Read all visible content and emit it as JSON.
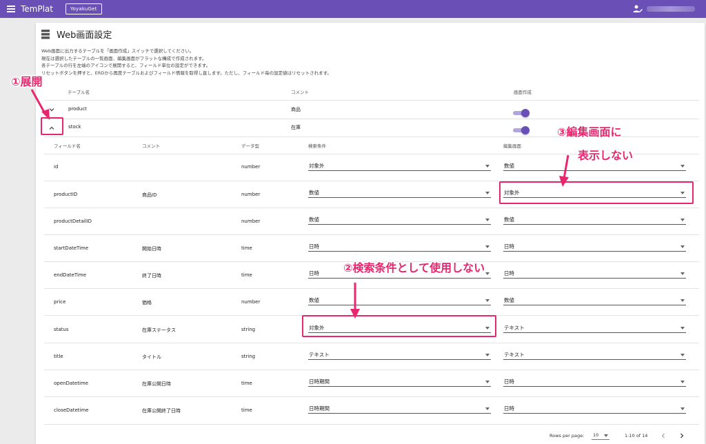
{
  "appbar": {
    "title": "TemPlat",
    "button": "YoyakuGet"
  },
  "page": {
    "title": "Web画面設定",
    "desc": [
      "Web画面に出力するテーブルを「画面作成」スイッチで選択してください。",
      "現在は選択したテーブルの一覧画面、編集画面がフラットな構成で作成されます。",
      "各テーブルの行を左端のアイコンで展開すると、フィールド単位の設定ができます。",
      "リセットボタンを押すと、ERDから再度テーブルおよびフィールド情報を取得し直します。ただし、フィールド毎の設定値はリセットされます。"
    ]
  },
  "table": {
    "headers": {
      "name": "テーブル名",
      "comment": "コメント",
      "create": "画面作成"
    },
    "rows": [
      {
        "name": "product",
        "comment": "商品",
        "enabled": true,
        "expanded": false
      },
      {
        "name": "stock",
        "comment": "在庫",
        "enabled": true,
        "expanded": true
      }
    ]
  },
  "fields": {
    "headers": {
      "name": "フィールド名",
      "comment": "コメント",
      "type": "データ型",
      "search": "検索条件",
      "edit": "編集画面"
    },
    "rows": [
      {
        "name": "id",
        "comment": "",
        "type": "number",
        "search": "対象外",
        "edit": "数値"
      },
      {
        "name": "productID",
        "comment": "商品ID",
        "type": "number",
        "search": "数値",
        "edit": "対象外"
      },
      {
        "name": "productDetailID",
        "comment": "",
        "type": "number",
        "search": "数値",
        "edit": "数値"
      },
      {
        "name": "startDateTime",
        "comment": "開始日時",
        "type": "time",
        "search": "日時",
        "edit": "日時"
      },
      {
        "name": "endDateTime",
        "comment": "終了日時",
        "type": "time",
        "search": "日時",
        "edit": "日時"
      },
      {
        "name": "price",
        "comment": "価格",
        "type": "number",
        "search": "数値",
        "edit": "数値"
      },
      {
        "name": "status",
        "comment": "在庫ステータス",
        "type": "string",
        "search": "対象外",
        "edit": "テキスト"
      },
      {
        "name": "title",
        "comment": "タイトル",
        "type": "string",
        "search": "テキスト",
        "edit": "テキスト"
      },
      {
        "name": "openDatetime",
        "comment": "在庫公開日時",
        "type": "time",
        "search": "日時期間",
        "edit": "日時"
      },
      {
        "name": "closeDatetime",
        "comment": "在庫公開終了日時",
        "type": "time",
        "search": "日時期間",
        "edit": "日時"
      }
    ]
  },
  "pagination": {
    "label": "Rows per page:",
    "value": "10",
    "range": "1-10 of 14"
  },
  "callouts": {
    "c1": "①展開",
    "c2": "②検索条件として使用しない",
    "c3a": "③編集画面に",
    "c3b": "表示しない"
  },
  "colors": {
    "appbar": "#6a4fb6",
    "accent": "#e8266e",
    "toggle": "#6a4fb6"
  }
}
